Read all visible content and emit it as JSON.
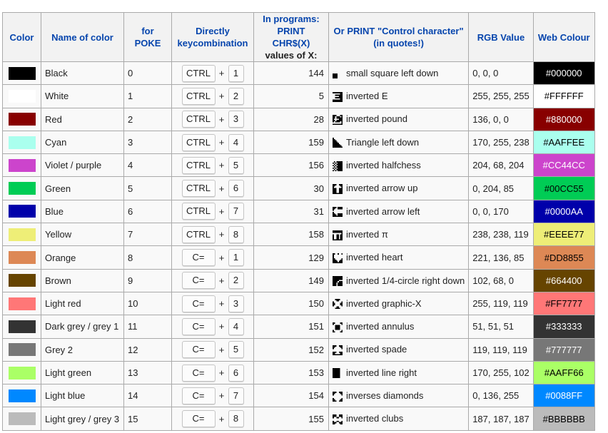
{
  "headers": {
    "color": "Color",
    "name": "Name of color",
    "poke": "for POKE",
    "keys_line1": "Directly",
    "keys_line2": "keycombination",
    "chr_line1": "In programs:",
    "chr_line2": "PRINT CHR$(X)",
    "chr_line3": "values of X:",
    "ctrl_line1": "Or PRINT \"Control character\"",
    "ctrl_line2": "(in quotes!)",
    "rgb": "RGB Value",
    "web": "Web Colour"
  },
  "rows": [
    {
      "name": "Black",
      "poke": "0",
      "mod": "CTRL",
      "plus": "+",
      "num": "1",
      "chr": "144",
      "glyph": "small-square-left-down-icon",
      "ctrl": "small square left down",
      "rgb": "0, 0, 0",
      "web": "#000000",
      "color": "#000000",
      "text": "#ffffff"
    },
    {
      "name": "White",
      "poke": "1",
      "mod": "CTRL",
      "plus": "+",
      "num": "2",
      "chr": "5",
      "glyph": "inverted-e-icon",
      "ctrl": "inverted E",
      "rgb": "255, 255, 255",
      "web": "#FFFFFF",
      "color": "#ffffff",
      "text": "#000000"
    },
    {
      "name": "Red",
      "poke": "2",
      "mod": "CTRL",
      "plus": "+",
      "num": "3",
      "chr": "28",
      "glyph": "inverted-pound-icon",
      "ctrl": "inverted pound",
      "rgb": "136, 0, 0",
      "web": "#880000",
      "color": "#880000",
      "text": "#ffffff"
    },
    {
      "name": "Cyan",
      "poke": "3",
      "mod": "CTRL",
      "plus": "+",
      "num": "4",
      "chr": "159",
      "glyph": "triangle-left-down-icon",
      "ctrl": "Triangle left down",
      "rgb": "170, 255, 238",
      "web": "#AAFFEE",
      "color": "#AAFFEE",
      "text": "#000000"
    },
    {
      "name": "Violet / purple",
      "poke": "4",
      "mod": "CTRL",
      "plus": "+",
      "num": "5",
      "chr": "156",
      "glyph": "inverted-halfchess-icon",
      "ctrl": "inverted halfchess",
      "rgb": "204, 68, 204",
      "web": "#CC44CC",
      "color": "#CC44CC",
      "text": "#ffffff"
    },
    {
      "name": "Green",
      "poke": "5",
      "mod": "CTRL",
      "plus": "+",
      "num": "6",
      "chr": "30",
      "glyph": "inverted-arrow-up-icon",
      "ctrl": "inverted arrow up",
      "rgb": "0, 204, 85",
      "web": "#00CC55",
      "color": "#00CC55",
      "text": "#000000"
    },
    {
      "name": "Blue",
      "poke": "6",
      "mod": "CTRL",
      "plus": "+",
      "num": "7",
      "chr": "31",
      "glyph": "inverted-arrow-left-icon",
      "ctrl": "inverted arrow left",
      "rgb": "0, 0, 170",
      "web": "#0000AA",
      "color": "#0000AA",
      "text": "#ffffff"
    },
    {
      "name": "Yellow",
      "poke": "7",
      "mod": "CTRL",
      "plus": "+",
      "num": "8",
      "chr": "158",
      "glyph": "inverted-pi-icon",
      "ctrl": "inverted π",
      "rgb": "238, 238, 119",
      "web": "#EEEE77",
      "color": "#EEEE77",
      "text": "#000000"
    },
    {
      "name": "Orange",
      "poke": "8",
      "mod": "C=",
      "plus": "+",
      "num": "1",
      "chr": "129",
      "glyph": "inverted-heart-icon",
      "ctrl": "inverted heart",
      "rgb": "221, 136, 85",
      "web": "#DD8855",
      "color": "#DD8855",
      "text": "#000000"
    },
    {
      "name": "Brown",
      "poke": "9",
      "mod": "C=",
      "plus": "+",
      "num": "2",
      "chr": "149",
      "glyph": "inverted-quarter-circle-icon",
      "ctrl": "inverted 1/4-circle right down",
      "rgb": "102, 68, 0",
      "web": "#664400",
      "color": "#664400",
      "text": "#ffffff"
    },
    {
      "name": "Light red",
      "poke": "10",
      "mod": "C=",
      "plus": "+",
      "num": "3",
      "chr": "150",
      "glyph": "inverted-graphic-x-icon",
      "ctrl": "inverted graphic-X",
      "rgb": "255, 119, 119",
      "web": "#FF7777",
      "color": "#FF7777",
      "text": "#000000"
    },
    {
      "name": "Dark grey / grey 1",
      "poke": "11",
      "mod": "C=",
      "plus": "+",
      "num": "4",
      "chr": "151",
      "glyph": "inverted-annulus-icon",
      "ctrl": "inverted annulus",
      "rgb": "51, 51, 51",
      "web": "#333333",
      "color": "#333333",
      "text": "#ffffff"
    },
    {
      "name": "Grey 2",
      "poke": "12",
      "mod": "C=",
      "plus": "+",
      "num": "5",
      "chr": "152",
      "glyph": "inverted-spade-icon",
      "ctrl": "inverted spade",
      "rgb": "119, 119, 119",
      "web": "#777777",
      "color": "#777777",
      "text": "#ffffff"
    },
    {
      "name": "Light green",
      "poke": "13",
      "mod": "C=",
      "plus": "+",
      "num": "6",
      "chr": "153",
      "glyph": "inverted-line-right-icon",
      "ctrl": "inverted line right",
      "rgb": "170, 255, 102",
      "web": "#AAFF66",
      "color": "#AAFF66",
      "text": "#000000"
    },
    {
      "name": "Light blue",
      "poke": "14",
      "mod": "C=",
      "plus": "+",
      "num": "7",
      "chr": "154",
      "glyph": "inverted-diamonds-icon",
      "ctrl": "inverses diamonds",
      "rgb": "0, 136, 255",
      "web": "#0088FF",
      "color": "#0088FF",
      "text": "#ffffff"
    },
    {
      "name": "Light grey / grey 3",
      "poke": "15",
      "mod": "C=",
      "plus": "+",
      "num": "8",
      "chr": "155",
      "glyph": "inverted-clubs-icon",
      "ctrl": "inverted clubs",
      "rgb": "187, 187, 187",
      "web": "#BBBBBB",
      "color": "#BBBBBB",
      "text": "#000000"
    }
  ]
}
